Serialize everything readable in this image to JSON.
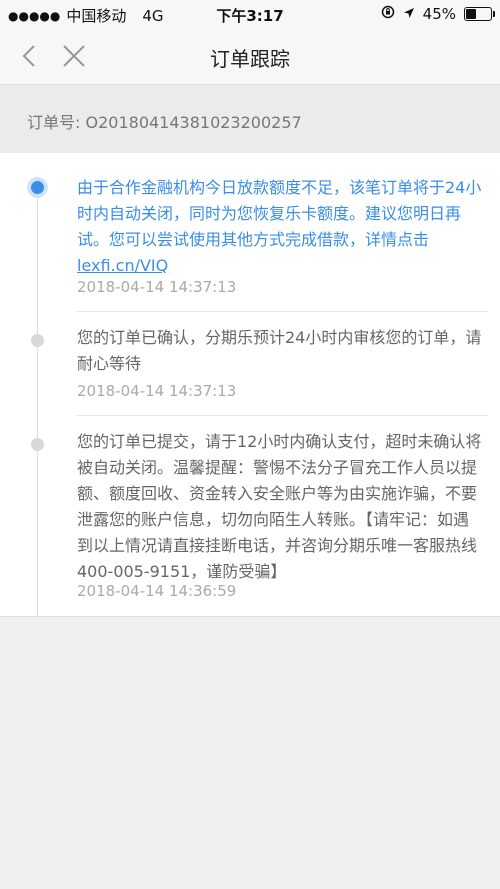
{
  "status_bar": {
    "signal": "●●●●●",
    "carrier": "中国移动",
    "network": "4G",
    "time": "下午3:17",
    "battery_percent": "45%",
    "battery_level": 0.45
  },
  "nav": {
    "title": "订单跟踪"
  },
  "order": {
    "label": "订单号:",
    "number": "O2018041438102320025 7"
  },
  "timeline": [
    {
      "message": "由于合作金融机构今日放款额度不足，该笔订单将于24小时内自动关闭，同时为您恢复乐卡额度。建议您明日再试。您可以尝试使用其他方式完成借款，详情点击",
      "link": "lexfi.cn/VIQ",
      "time": "2018-04-14 14:37:13"
    },
    {
      "message": "您的订单已确认，分期乐预计24小时内审核您的订单，请耐心等待",
      "time": "2018-04-14 14:37:13"
    },
    {
      "message": "您的订单已提交，请于12小时内确认支付，超时未确认将被自动关闭。温馨提醒：警惕不法分子冒充工作人员以提额、额度回收、资金转入安全账户等为由实施诈骗，不要泄露您的账户信息，切勿向陌生人转账。【请牢记：如遇到以上情况请直接挂断电话，并咨询分期乐唯一客服热线400-005-9151，谨防受骗】",
      "time": "2018-04-14 14:36:59"
    }
  ]
}
